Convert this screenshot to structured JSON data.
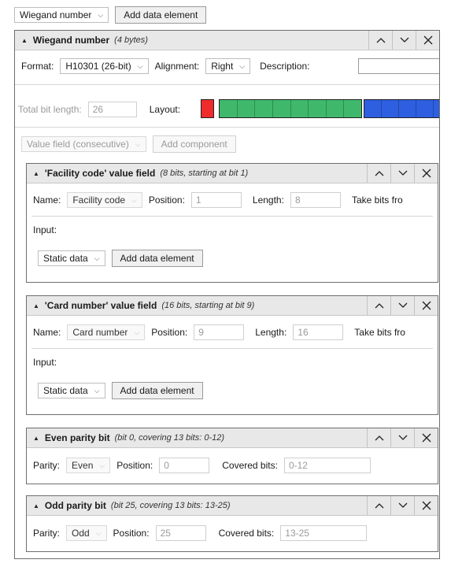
{
  "toolbar": {
    "select": "Wiegand number",
    "add_button": "Add data element"
  },
  "main": {
    "title": "Wiegand number",
    "subtitle": "(4 bytes)",
    "format_label": "Format:",
    "format_value": "H10301 (26-bit)",
    "alignment_label": "Alignment:",
    "alignment_value": "Right",
    "description_label": "Description:",
    "description_value": "",
    "total_bits_label": "Total bit length:",
    "total_bits_value": "26",
    "layout_label": "Layout:",
    "layout_colors": {
      "parity": "#ef2b2b",
      "facility": "#3fb86b",
      "card": "#2e5fe0"
    },
    "component_type": "Value field (consecutive)",
    "add_component": "Add component"
  },
  "fields": [
    {
      "title": "'Facility code' value field",
      "subtitle": "(8 bits, starting at bit 1)",
      "name_label": "Name:",
      "name_value": "Facility code",
      "position_label": "Position:",
      "position_value": "1",
      "length_label": "Length:",
      "length_value": "8",
      "take_bits": "Take bits fro",
      "input_label": "Input:",
      "input_type": "Static data",
      "add_button": "Add data element"
    },
    {
      "title": "'Card number' value field",
      "subtitle": "(16 bits, starting at bit 9)",
      "name_label": "Name:",
      "name_value": "Card number",
      "position_label": "Position:",
      "position_value": "9",
      "length_label": "Length:",
      "length_value": "16",
      "take_bits": "Take bits fro",
      "input_label": "Input:",
      "input_type": "Static data",
      "add_button": "Add data element"
    }
  ],
  "parity": [
    {
      "title": "Even parity bit",
      "subtitle": "(bit 0, covering 13 bits: 0-12)",
      "parity_label": "Parity:",
      "parity_value": "Even",
      "position_label": "Position:",
      "position_value": "0",
      "covered_label": "Covered bits:",
      "covered_value": "0-12"
    },
    {
      "title": "Odd parity bit",
      "subtitle": "(bit 25, covering 13 bits: 13-25)",
      "parity_label": "Parity:",
      "parity_value": "Odd",
      "position_label": "Position:",
      "position_value": "25",
      "covered_label": "Covered bits:",
      "covered_value": "13-25"
    }
  ]
}
